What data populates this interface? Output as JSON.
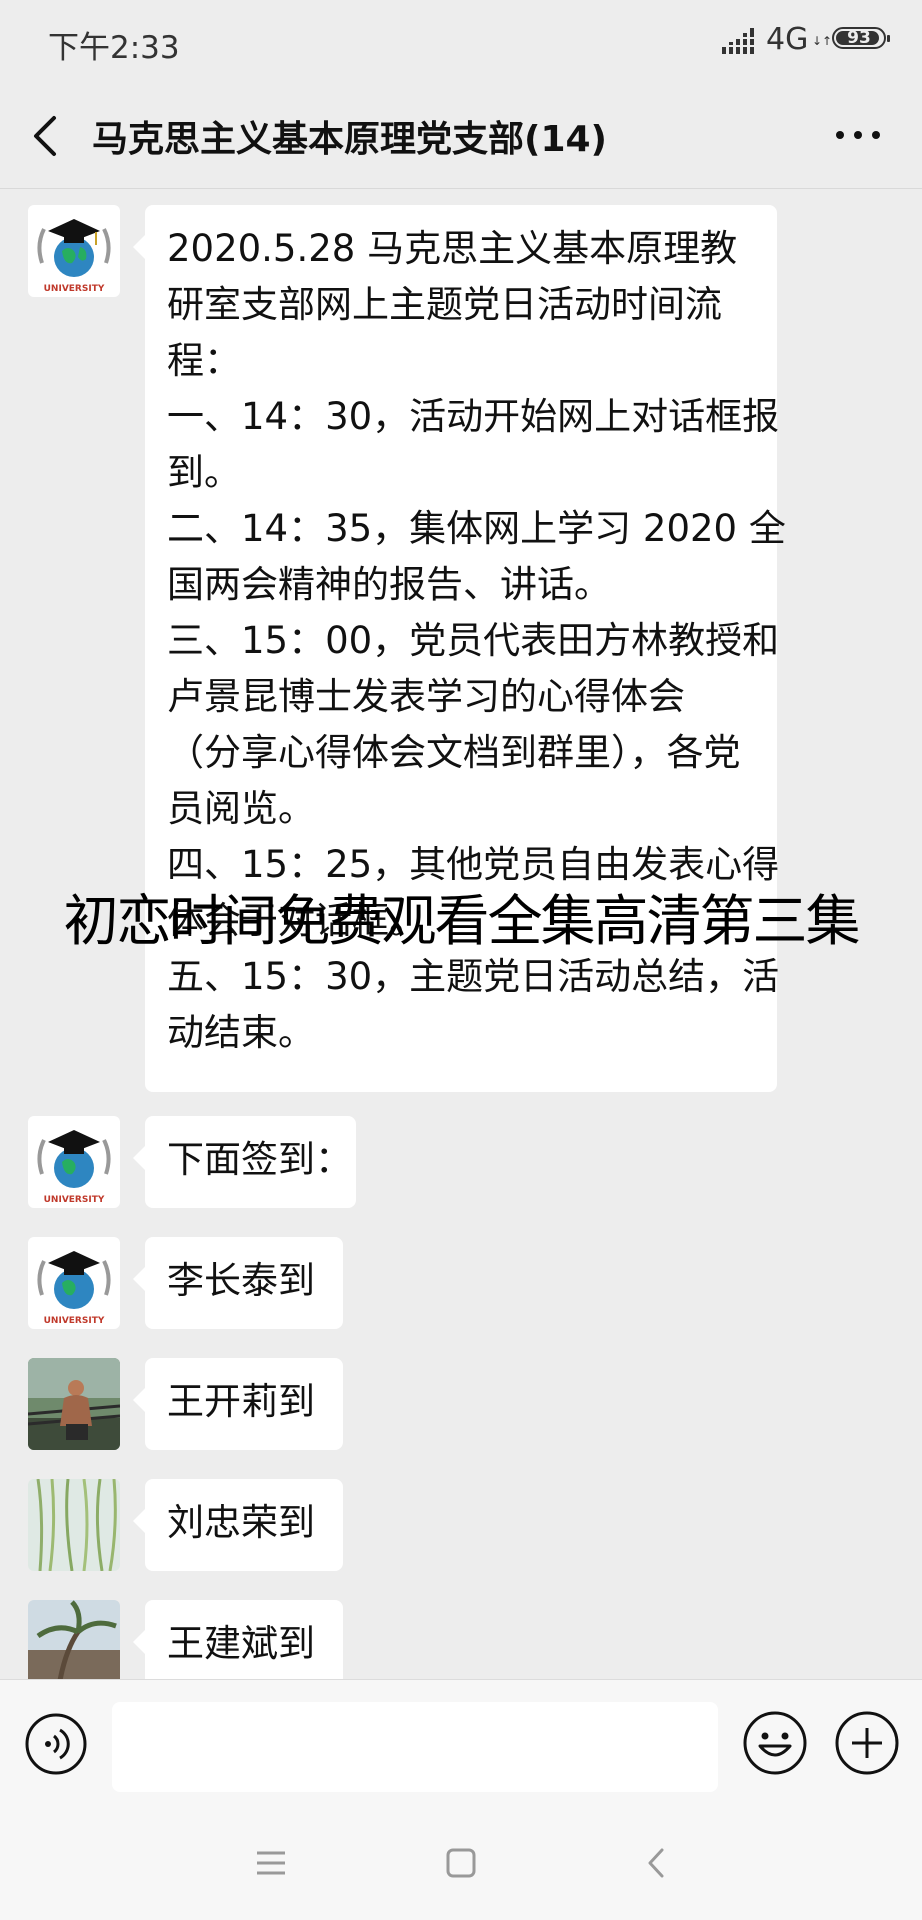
{
  "status_bar": {
    "time": "下午2:33",
    "network": "4G",
    "network_arrows": "↓↑",
    "battery": "93",
    "battery_level": 0.93
  },
  "header": {
    "title": "马克思主义基本原理党支部(14)"
  },
  "messages": [
    {
      "sender_avatar": "graduation-globe-logo",
      "lines": [
        "2020.5.28 马克思主义基本原理教",
        "研室支部网上主题党日活动时间流",
        "程：",
        "一、14：30，活动开始网上对话框报",
        "到。",
        "二、14：35，集体网上学习 2020 全",
        "国两会精神的报告、讲话。",
        "三、15：00，党员代表田方林教授和",
        "卢景昆博士发表学习的心得体会",
        "（分享心得体会文档到群里），各党",
        "员阅览。",
        "四、15：25，其他党员自由发表心得",
        "体会于对话框。",
        "五、15：30，主题党日活动总结，活",
        "动结束。"
      ]
    },
    {
      "sender_avatar": "graduation-globe-logo",
      "text": "下面签到："
    },
    {
      "sender_avatar": "graduation-globe-logo",
      "text": "李长泰到"
    },
    {
      "sender_avatar": "man-outdoor-photo",
      "text": "王开莉到"
    },
    {
      "sender_avatar": "willow-tree-photo",
      "text": "刘忠荣到"
    },
    {
      "sender_avatar": "palm-tree-photo",
      "text": "王建斌到"
    }
  ],
  "avatar_logo_text": "UNIVERSITY",
  "overlay_text": "初恋时间免费观看全集高清第三集",
  "input": {
    "placeholder": "",
    "value": ""
  },
  "colors": {
    "background": "#ededed",
    "bubble": "#ffffff",
    "logo_red": "#c0392b",
    "globe_blue": "#2e86c1"
  }
}
